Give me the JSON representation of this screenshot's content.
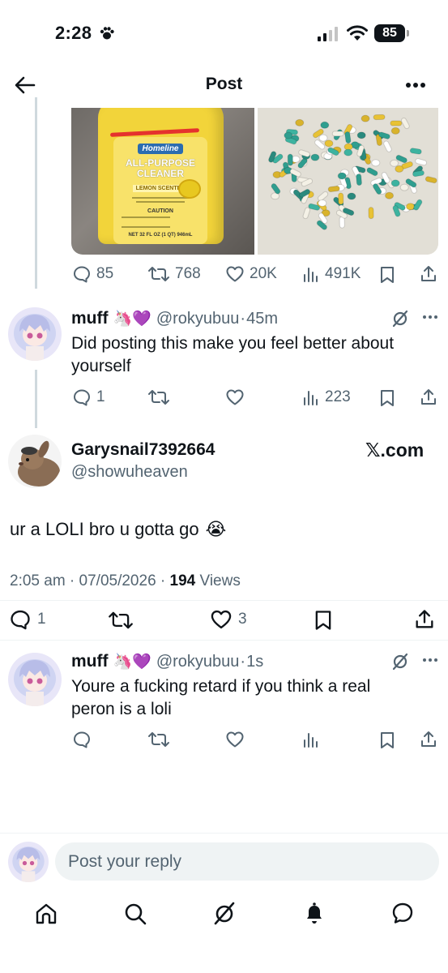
{
  "status": {
    "time": "2:28",
    "battery": "85"
  },
  "header": {
    "title": "Post"
  },
  "quoted_tweet": {
    "images": [
      {
        "icon": "cleaner-bottle-photo",
        "brand": "Homeline",
        "title": "ALL-PURPOSE CLEANER",
        "scent": "LEMON SCENTED",
        "caution": "CAUTION",
        "net": "NET 32 FL OZ (1 QT) 946mL"
      },
      {
        "icon": "pills-photo"
      }
    ],
    "stats": {
      "replies": "85",
      "reposts": "768",
      "likes": "20K",
      "views": "491K"
    }
  },
  "reply1": {
    "name": "muff",
    "emoji": "🦄💜",
    "handle": "@rokyubuu",
    "time": "45m",
    "text": "Did posting this make you feel better about yourself",
    "replies": "1",
    "views": "223"
  },
  "main_tweet": {
    "name": "Garysnail7392664",
    "handle": "@showuheaven",
    "source_label": "𝕏.com",
    "text": "ur a LOLI bro u gotta go",
    "text_emoji": "😭",
    "timestamp": "2:05 am · 07/05/2026 · ",
    "views_count": "194",
    "views_label": " Views",
    "replies": "1",
    "likes": "3"
  },
  "reply2": {
    "name": "muff",
    "emoji": "🦄💜",
    "handle": "@rokyubuu",
    "time": "1s",
    "text": "Youre a fucking retard if you think a real peron is a loli"
  },
  "composer": {
    "placeholder": "Post your reply"
  },
  "bottom_nav": [
    "home-icon",
    "search-icon",
    "grok-icon",
    "notifications-icon",
    "messages-icon"
  ],
  "colors": {
    "accent": "#1d9bf0",
    "secondary_text": "#536471",
    "divider": "#eff3f4",
    "purple_heart": "#9b5de5"
  }
}
